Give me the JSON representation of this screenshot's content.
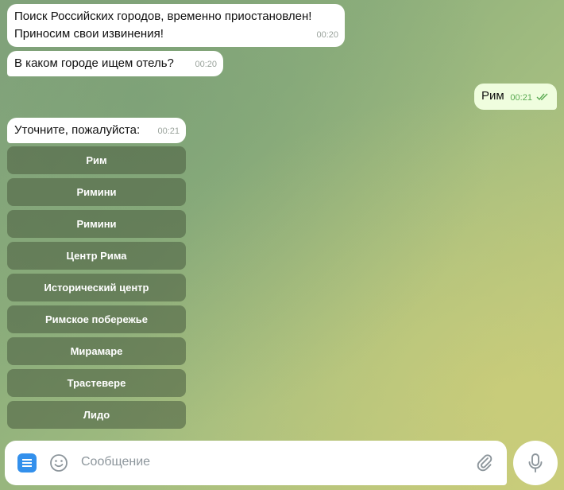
{
  "messages": [
    {
      "lines": [
        "Поиск Российских городов, временно приостановлен!",
        "Приносим свои извинения!"
      ],
      "time": "00:20"
    },
    {
      "text": "В каком городе ищем отель?",
      "time": "00:20"
    },
    {
      "text": "Рим",
      "time": "00:21"
    },
    {
      "text": "Уточните, пожалуйста:",
      "time": "00:21"
    }
  ],
  "keyboard": [
    "Рим",
    "Римини",
    "Римини",
    "Центр Рима",
    "Исторический центр",
    "Римское побережье",
    "Мирамаре",
    "Трастевере",
    "Лидо"
  ],
  "composer": {
    "placeholder": "Сообщение"
  },
  "icons": {
    "menu": "menu-icon",
    "emoji": "emoji-icon",
    "attach": "paperclip-icon",
    "mic": "microphone-icon",
    "read": "double-check-icon"
  },
  "colors": {
    "menu_button": "#3390ec",
    "outgoing_bubble": "#effdde",
    "keyboard_button": "#5e7556"
  }
}
